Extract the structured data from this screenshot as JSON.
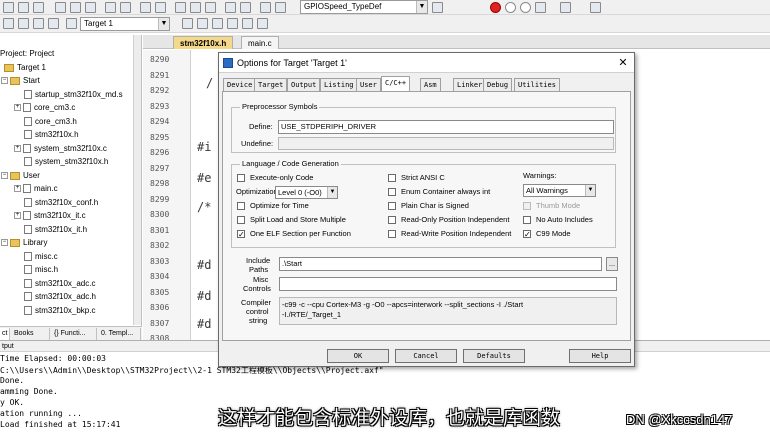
{
  "toolbar": {
    "target_select": "Target 1",
    "func_select": "GPIOSpeed_TypeDef"
  },
  "project": {
    "root": "Project: Project",
    "target": "Target 1",
    "groups": [
      {
        "name": "Start",
        "files": [
          "startup_stm32f10x_md.s",
          "core_cm3.c",
          "core_cm3.h",
          "stm32f10x.h",
          "system_stm32f10x.c",
          "system_stm32f10x.h"
        ]
      },
      {
        "name": "User",
        "files": [
          "main.c",
          "stm32f10x_conf.h",
          "stm32f10x_it.c",
          "stm32f10x_it.h"
        ]
      },
      {
        "name": "Library",
        "files": [
          "misc.c",
          "misc.h",
          "stm32f10x_adc.c",
          "stm32f10x_adc.h",
          "stm32f10x_bkp.c"
        ]
      }
    ],
    "tabs": [
      "ct",
      "Books",
      "{} Functi...",
      "0. Templ..."
    ]
  },
  "editor": {
    "tabs": [
      "stm32f10x.h",
      "main.c"
    ],
    "line_numbers": [
      "8290",
      "8291",
      "8292",
      "8293",
      "8294",
      "8295",
      "8296",
      "8297",
      "8298",
      "8299",
      "8300",
      "8301",
      "8302",
      "8303",
      "8304",
      "8305",
      "8306",
      "8307",
      "8308"
    ],
    "code_fragments": [
      "/",
      "#i",
      "#e",
      "/*",
      "#d",
      "#d",
      "#d"
    ]
  },
  "output": {
    "title": "tput",
    "lines": [
      "Time Elapsed:  00:00:03",
      "C:\\\\Users\\\\Admin\\\\Desktop\\\\STM32Project\\\\2-1 STM32工程模板\\\\Objects\\\\Project.axf\"",
      " Done.",
      "amming Done.",
      "y OK.",
      "ation running ...",
      "Load finished at 15:17:41"
    ]
  },
  "dialog": {
    "title": "Options for Target 'Target 1'",
    "close": "✕",
    "tabs": [
      "Device",
      "Target",
      "Output",
      "Listing",
      "User",
      "C/C++",
      "Asm",
      "Linker",
      "Debug",
      "Utilities"
    ],
    "active_tab": "C/C++",
    "preprocessor": {
      "group": "Preprocessor Symbols",
      "define_label": "Define:",
      "define_value": "USE_STDPERIPH_DRIVER",
      "undefine_label": "Undefine:",
      "undefine_value": ""
    },
    "codegen": {
      "group": "Language / Code Generation",
      "execute_only": "Execute-only Code",
      "optimization_label": "Optimization:",
      "optimization_value": "Level 0 (-O0)",
      "optimize_time": "Optimize for Time",
      "split_load": "Split Load and Store Multiple",
      "one_elf": "One ELF Section per Function",
      "strict_ansi": "Strict ANSI C",
      "enum_container": "Enum Container always int",
      "plain_char": "Plain Char is Signed",
      "ro_pi": "Read-Only Position Independent",
      "rw_pi": "Read-Write Position Independent",
      "warnings_label": "Warnings:",
      "warnings_value": "All Warnings",
      "thumb_mode": "Thumb Mode",
      "no_auto_includes": "No Auto Includes",
      "c99_mode": "C99 Mode"
    },
    "include_label_1": "Include",
    "include_label_2": "Paths",
    "include_value": ".\\Start",
    "browse": "...",
    "misc_label_1": "Misc",
    "misc_label_2": "Controls",
    "misc_value": "",
    "compiler_label_1": "Compiler",
    "compiler_label_2": "control",
    "compiler_label_3": "string",
    "compiler_line1": "-c99 -c --cpu Cortex-M3 -g -O0 --apcs=interwork --split_sections -I ./Start",
    "compiler_line2": "-I./RTE/_Target_1",
    "buttons": {
      "ok": "OK",
      "cancel": "Cancel",
      "defaults": "Defaults",
      "help": "Help"
    }
  },
  "subtitle": "这样才能包含标准外设库，也就是库函数",
  "watermark": "DN @Xkccsdn147"
}
